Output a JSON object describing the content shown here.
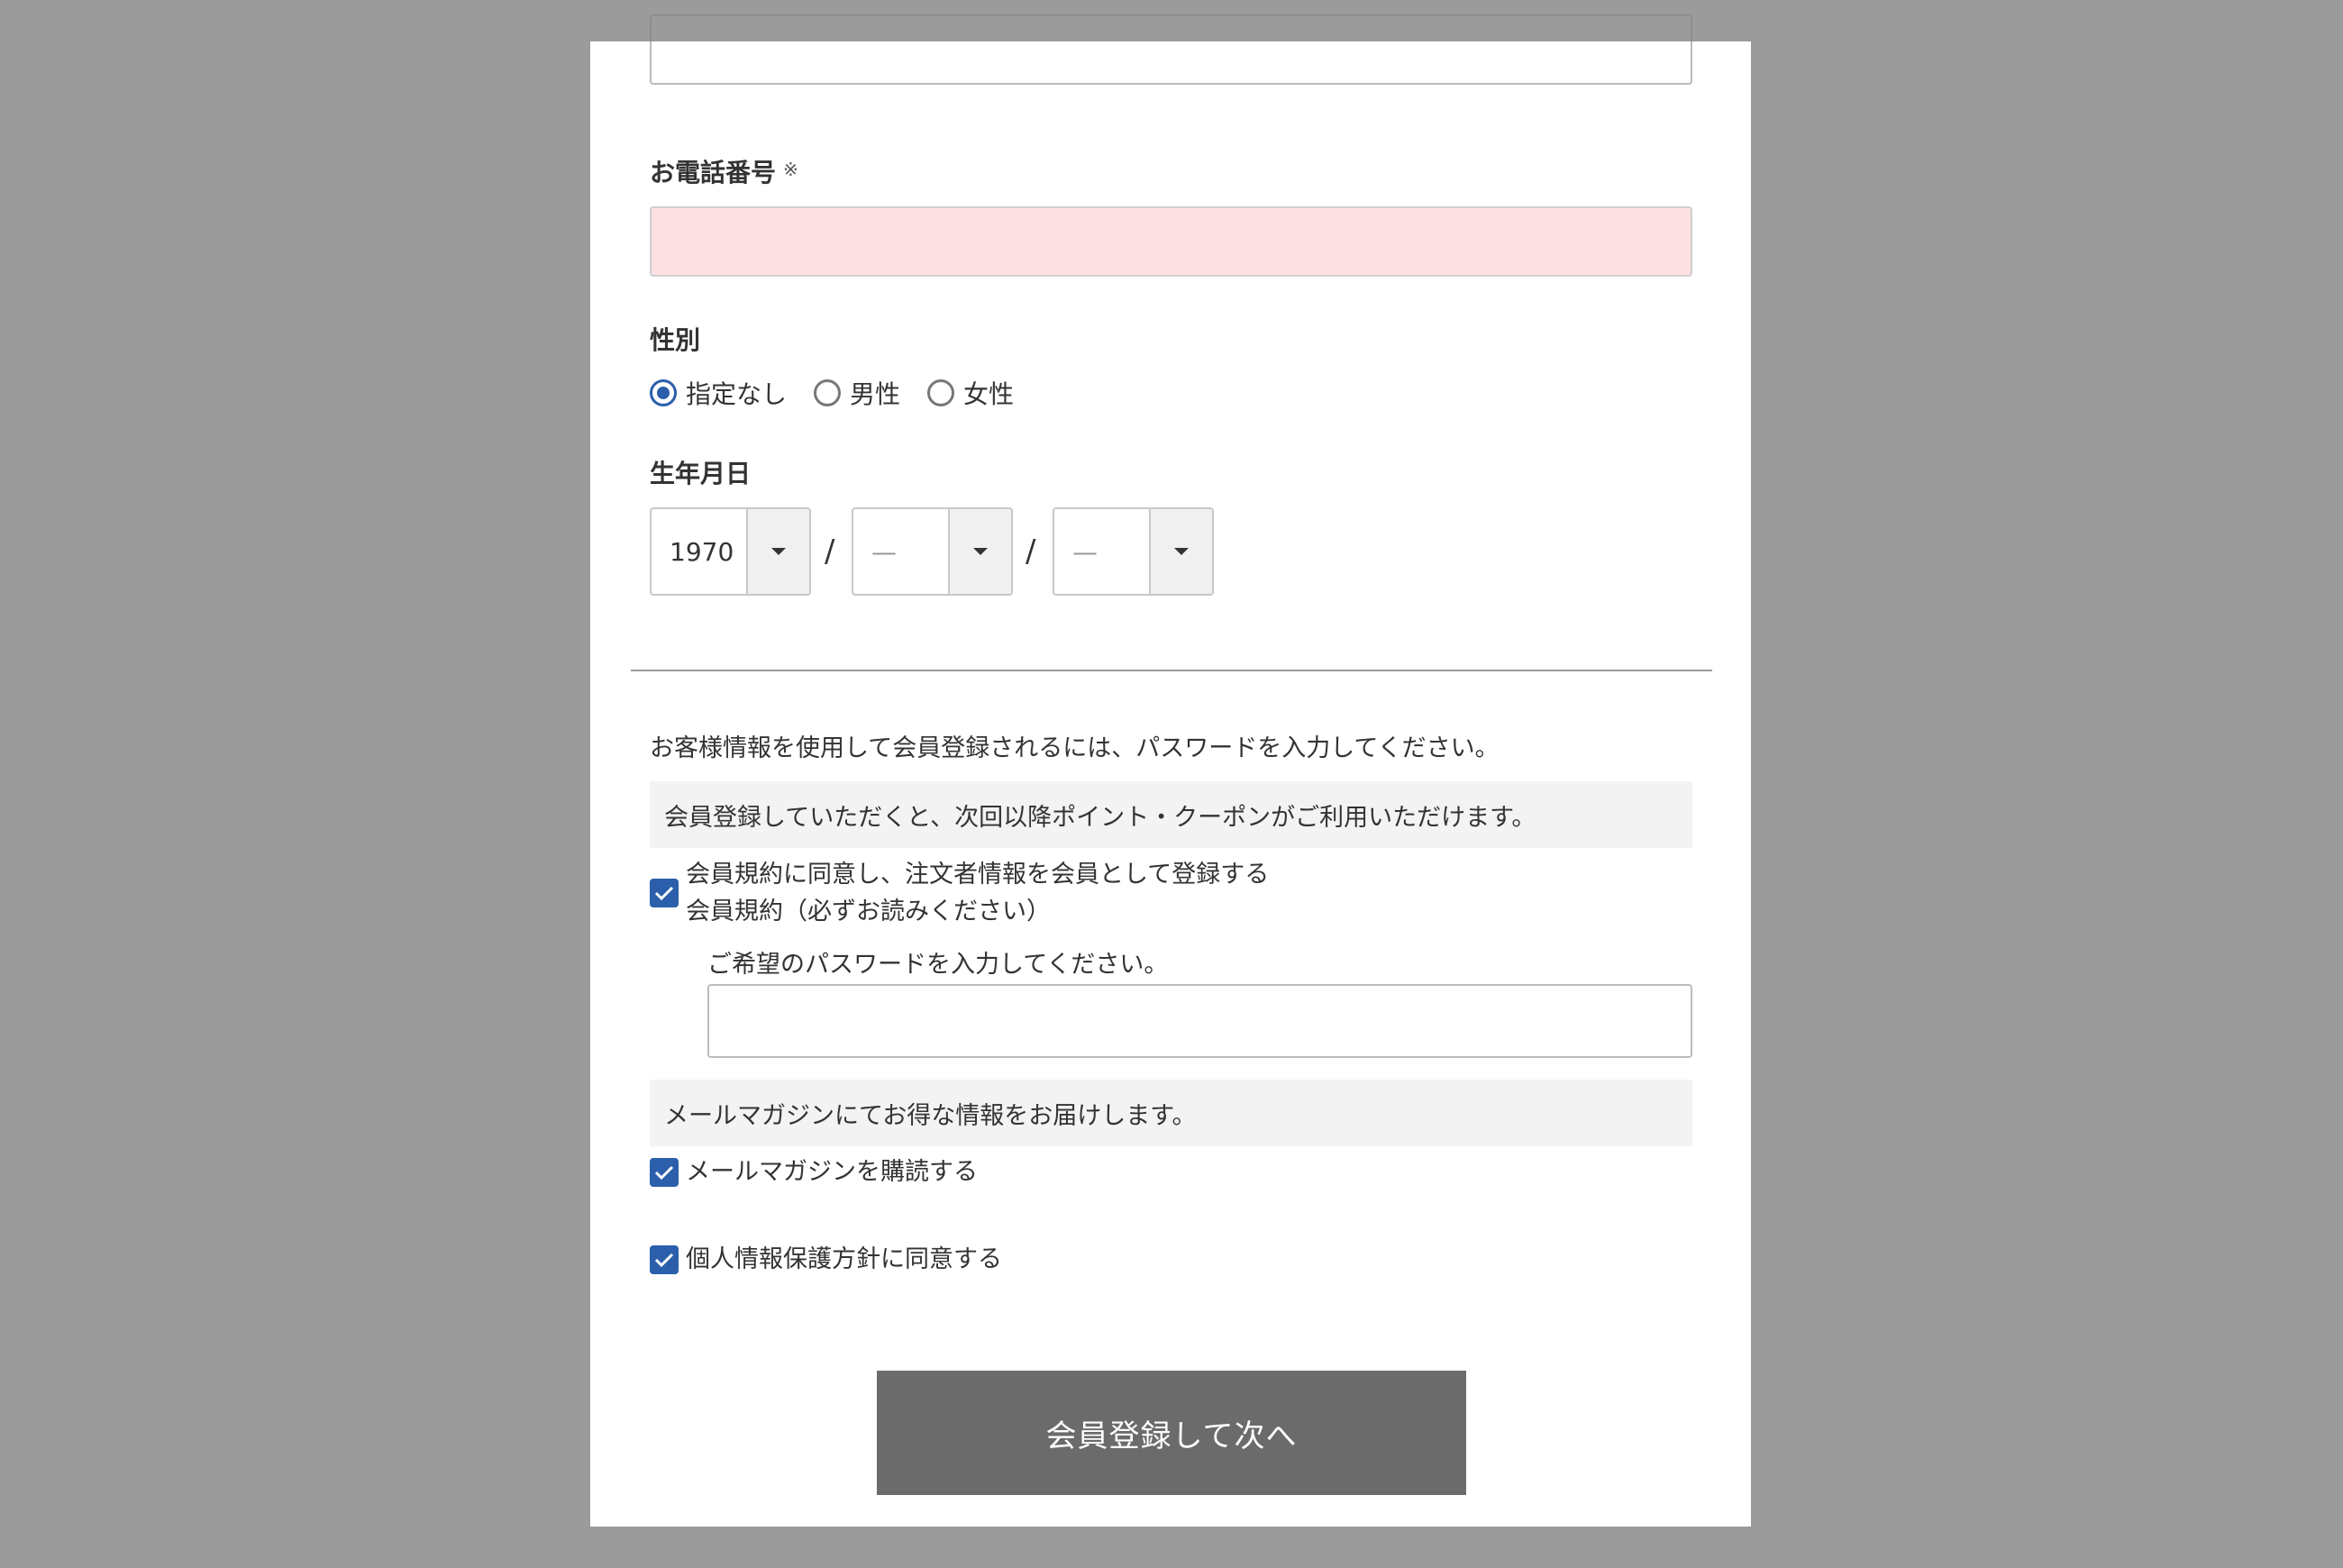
{
  "phone": {
    "label": "お電話番号",
    "required_mark": "※",
    "value": ""
  },
  "gender": {
    "label": "性別",
    "options": [
      "指定なし",
      "男性",
      "女性"
    ],
    "selected": "指定なし"
  },
  "birthday": {
    "label": "生年月日",
    "year": "1970",
    "month": "—",
    "day": "—",
    "separator": "/"
  },
  "membership": {
    "intro": "お客様情報を使用して会員登録されるには、パスワードを入力してください。",
    "benefit_note": "会員登録していただくと、次回以降ポイント・クーポンがご利用いただけます。",
    "agree_label": "会員規約に同意し、注文者情報を会員として登録する",
    "terms_link": "会員規約（必ずお読みください）",
    "agree_checked": true,
    "password_prompt": "ご希望のパスワードを入力してください。",
    "password_value": ""
  },
  "newsletter": {
    "note": "メールマガジンにてお得な情報をお届けします。",
    "label": "メールマガジンを購読する",
    "checked": true
  },
  "privacy": {
    "label": "個人情報保護方針に同意する",
    "checked": true
  },
  "submit": {
    "label": "会員登録して次へ"
  },
  "colors": {
    "accent": "#2b5fab",
    "required_field_bg": "#fde0e1",
    "button_bg": "#6b6b6b",
    "overlay": "#9b9b9b"
  }
}
